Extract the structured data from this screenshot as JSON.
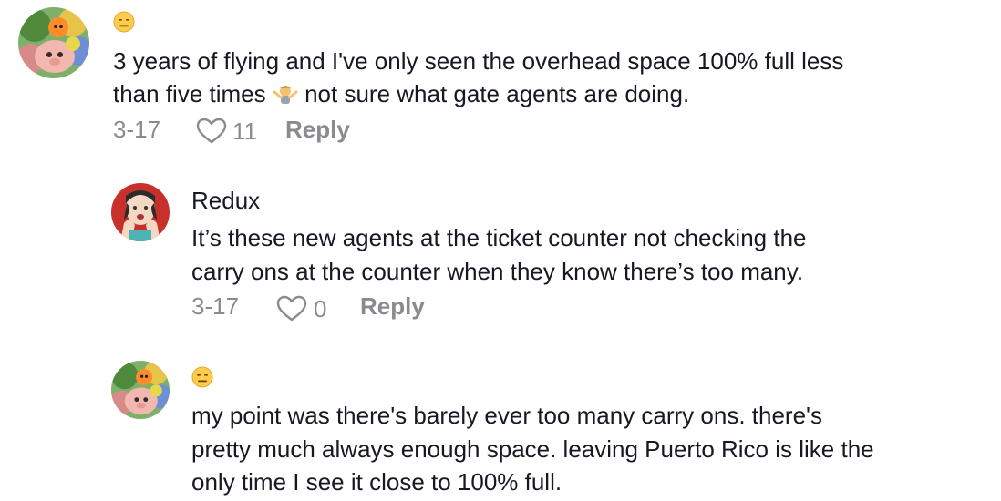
{
  "comments": [
    {
      "author_emoji": "😑",
      "text_line1": "3 years of flying and I've only seen the overhead space 100% full less",
      "text_line2_a": "than five times",
      "text_line2_emoji": "🤷",
      "text_line2_b": " not sure what gate agents are doing.",
      "date": "3-17",
      "likes": "11",
      "reply_label": "Reply"
    },
    {
      "author": "Redux",
      "text_line1": "It’s these new agents at the ticket counter not checking the",
      "text_line2": "carry ons at the counter when they know there’s too many.",
      "date": "3-17",
      "likes": "0",
      "reply_label": "Reply"
    },
    {
      "author_emoji": "😑",
      "text_line1": "my point was there's barely ever too many carry ons. there's",
      "text_line2": "pretty much always enough space. leaving Puerto Rico is like the",
      "text_line3": "only time I see it close to 100% full."
    }
  ],
  "icons": {
    "heart": "heart-outline-icon",
    "expressionless": "expressionless-face-emoji"
  },
  "colors": {
    "text": "#161823",
    "meta": "#8a8b91",
    "redux_avatar_bg": "#c8312b"
  }
}
